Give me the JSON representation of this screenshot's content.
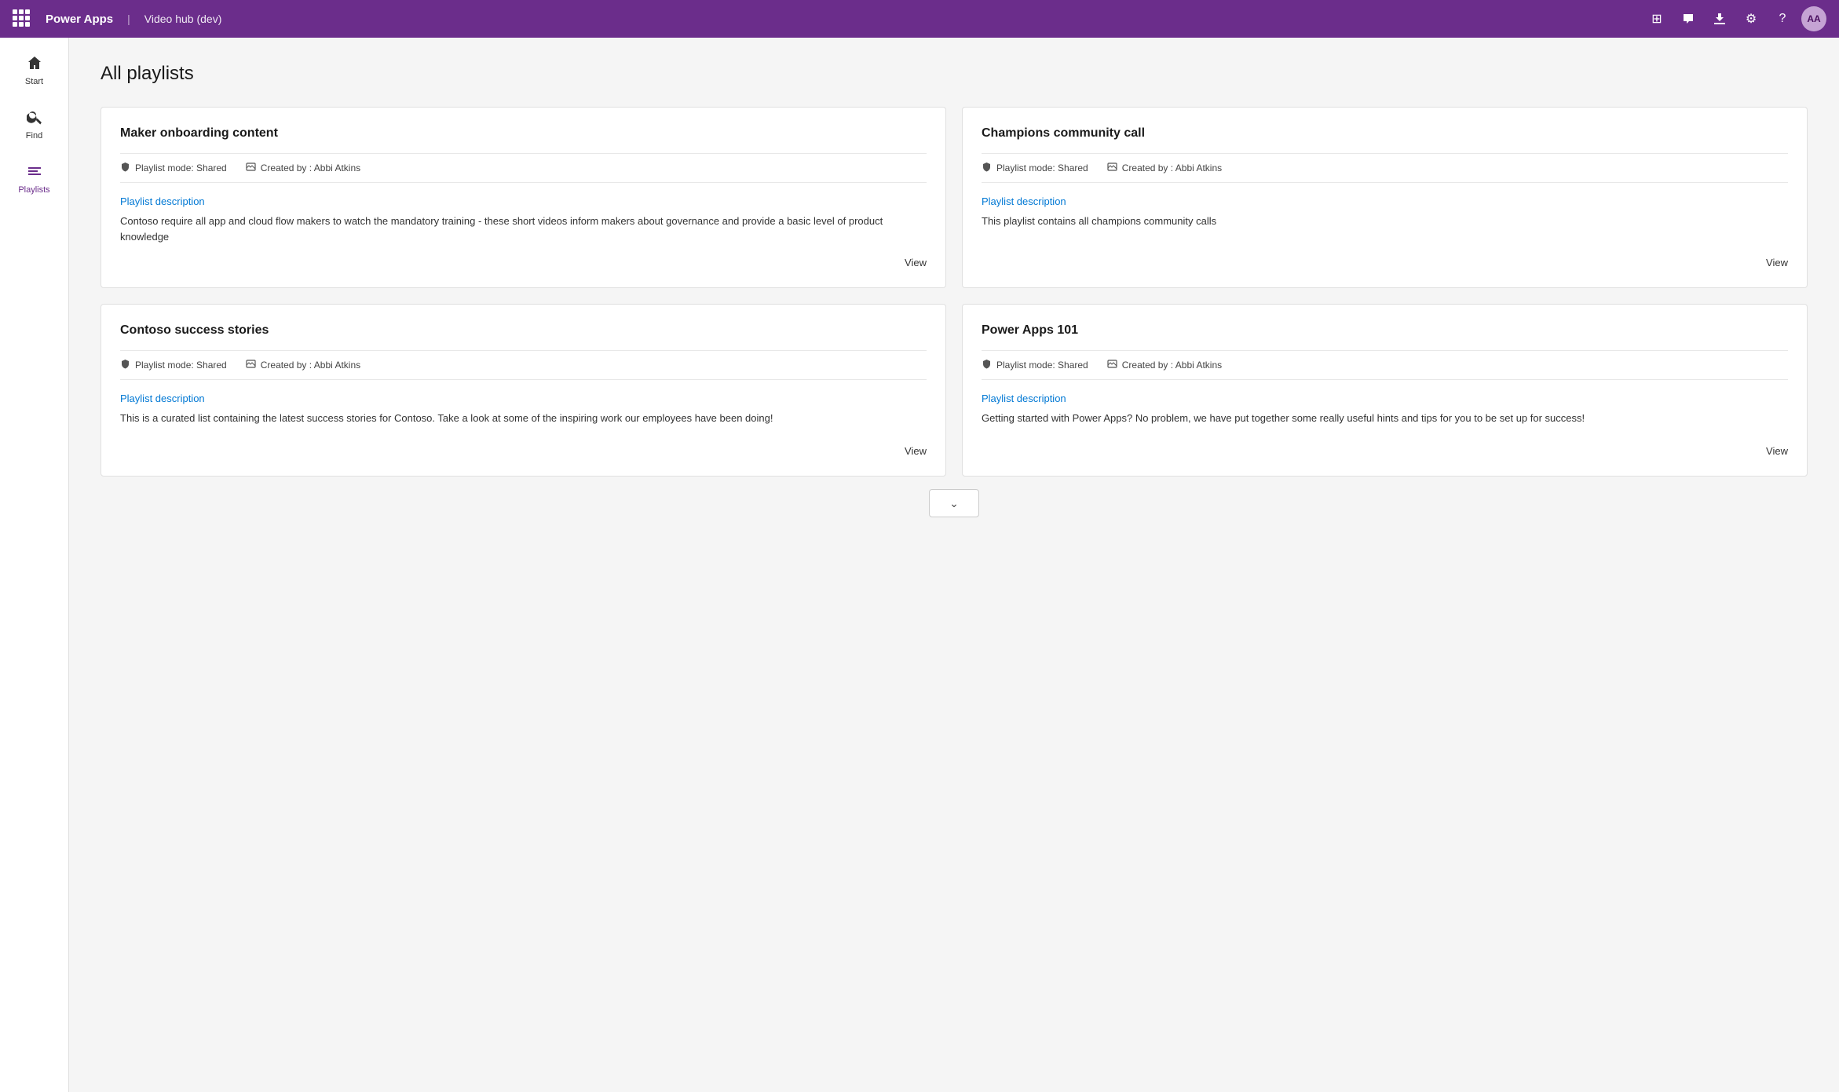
{
  "header": {
    "app_name": "Power Apps",
    "separator": "|",
    "app_subtitle": "Video hub (dev)",
    "icons": {
      "waffle": "waffle",
      "apps": "⊞",
      "chat": "💬",
      "download": "⬇",
      "settings": "⚙",
      "help": "?",
      "avatar": "AA"
    }
  },
  "sidebar": {
    "items": [
      {
        "id": "start",
        "label": "Start",
        "icon": "🏠"
      },
      {
        "id": "find",
        "label": "Find",
        "icon": "🔍"
      },
      {
        "id": "playlists",
        "label": "Playlists",
        "icon": "≡"
      }
    ]
  },
  "page": {
    "title": "All playlists"
  },
  "playlists": [
    {
      "id": "maker-onboarding",
      "title": "Maker onboarding content",
      "mode_label": "Playlist mode: Shared",
      "created_label": "Created by : Abbi Atkins",
      "description_heading": "Playlist description",
      "description": "Contoso require all app and cloud flow makers to watch the mandatory training - these short videos inform makers about governance and provide a basic level of product knowledge",
      "view_label": "View"
    },
    {
      "id": "champions-community",
      "title": "Champions community call",
      "mode_label": "Playlist mode: Shared",
      "created_label": "Created by : Abbi Atkins",
      "description_heading": "Playlist description",
      "description": "This playlist contains all champions community calls",
      "view_label": "View"
    },
    {
      "id": "contoso-success",
      "title": "Contoso success stories",
      "mode_label": "Playlist mode: Shared",
      "created_label": "Created by : Abbi Atkins",
      "description_heading": "Playlist description",
      "description": "This is a curated list containing the latest success stories for Contoso.  Take a look at some of the inspiring work our employees have been doing!",
      "view_label": "View"
    },
    {
      "id": "power-apps-101",
      "title": "Power Apps 101",
      "mode_label": "Playlist mode: Shared",
      "created_label": "Created by : Abbi Atkins",
      "description_heading": "Playlist description",
      "description": "Getting started with Power Apps?  No problem, we have put together some really useful hints and tips for you to be set up for success!",
      "view_label": "View"
    }
  ],
  "scroll_down": "⌄"
}
